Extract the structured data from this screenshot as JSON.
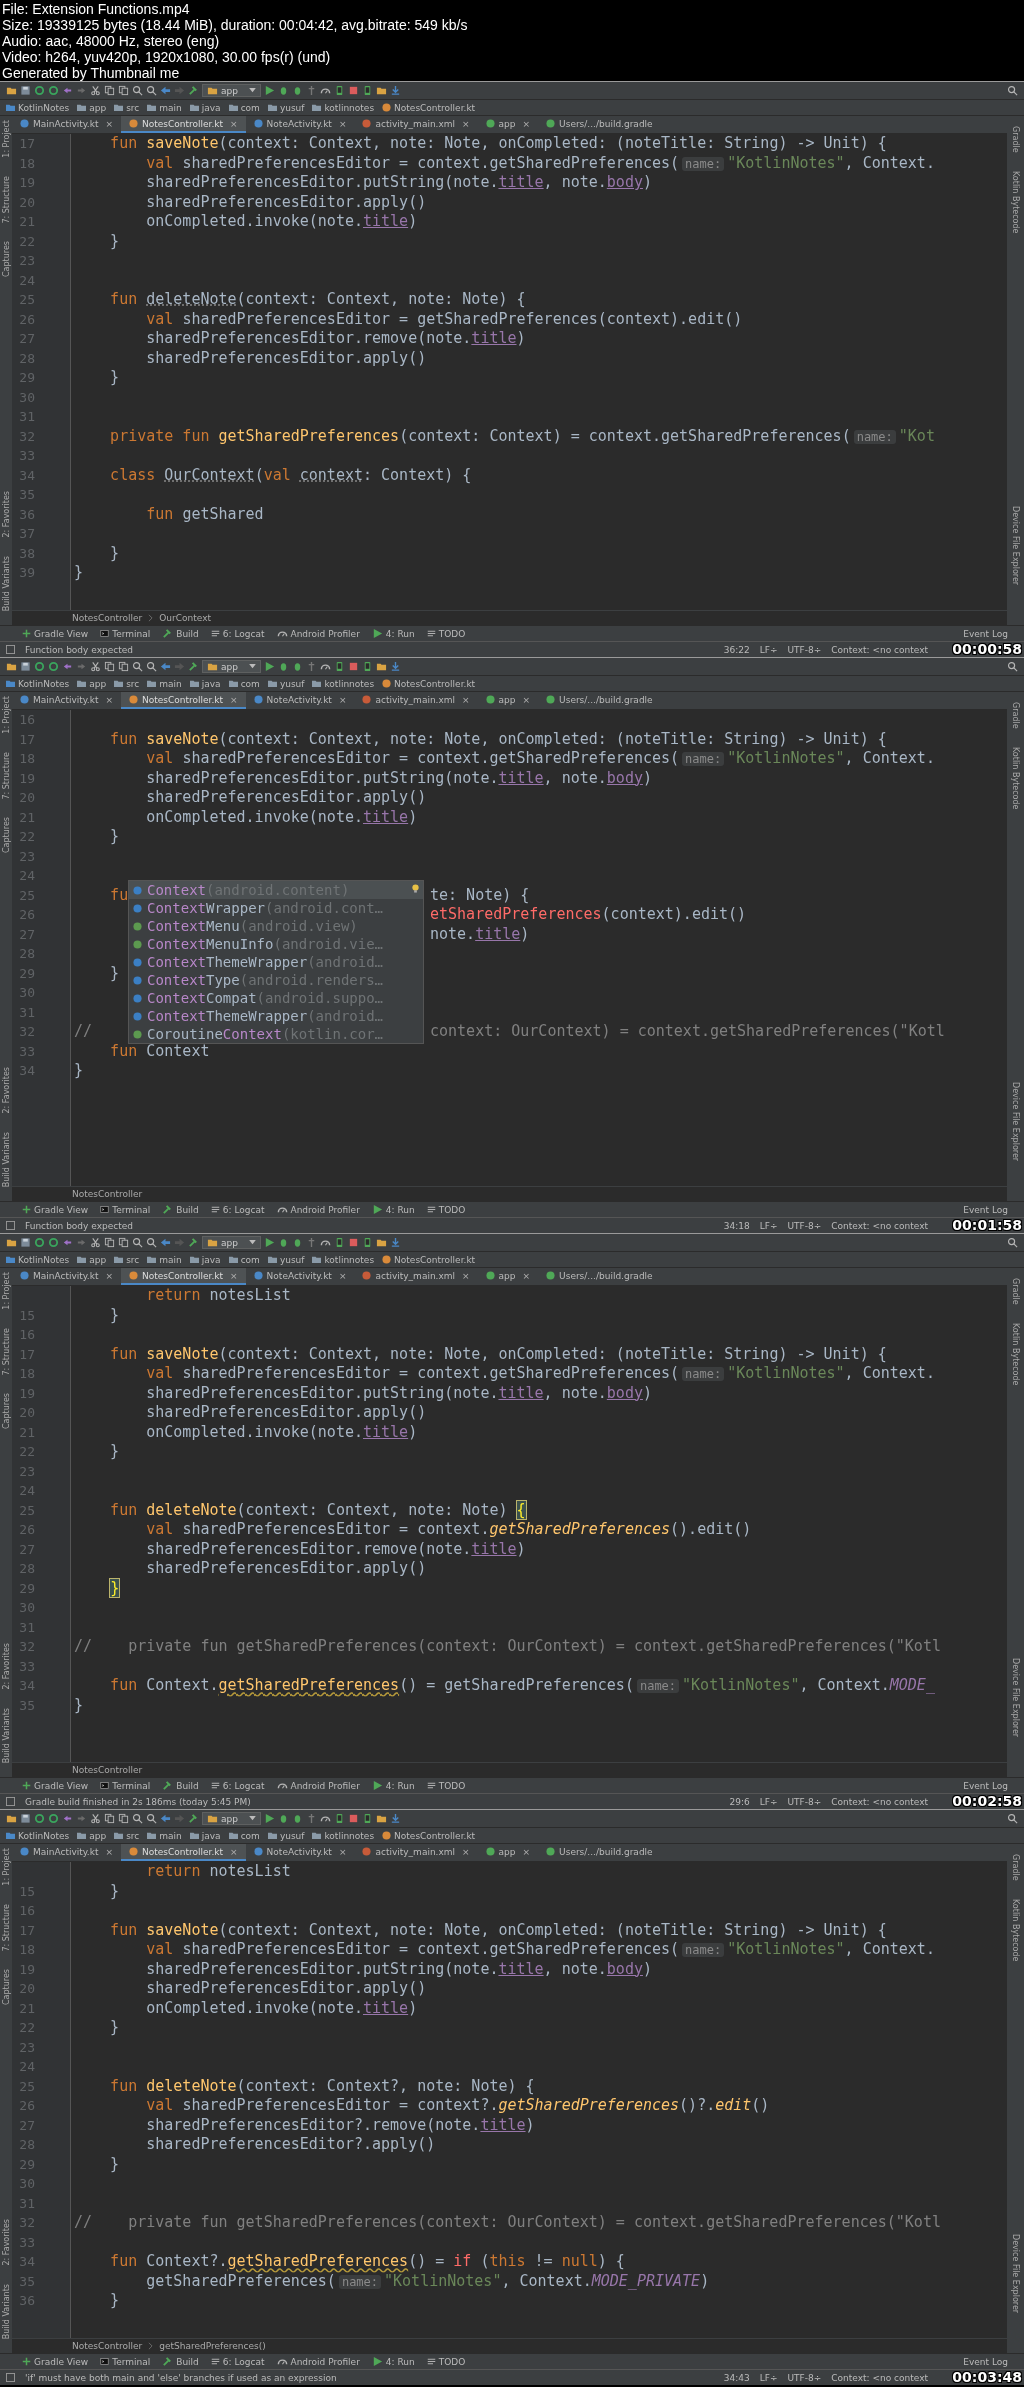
{
  "info": [
    "File: Extension Functions.mp4",
    "Size: 19339125 bytes (18.44 MiB), duration: 00:04:42, avg.bitrate: 549 kb/s",
    "Audio: aac, 48000 Hz, stereo (eng)",
    "Video: h264, yuv420p, 1920x1080, 30.00 fps(r) (und)",
    "Generated by Thumbnail me"
  ],
  "frames": [
    {
      "timestamp": "00:00:58",
      "run_config": "app",
      "breadcrumbs": [
        "KotlinNotes",
        "app",
        "src",
        "main",
        "java",
        "com",
        "yusuf",
        "kotlinnotes",
        "NotesController.kt"
      ],
      "tabs": [
        {
          "label": "MainActivity.kt",
          "kind": "kotlin-class",
          "selected": false,
          "close": "×"
        },
        {
          "label": "NotesController.kt",
          "kind": "kotlin-file",
          "selected": true,
          "close": "×"
        },
        {
          "label": "NoteActivity.kt",
          "kind": "kotlin-class",
          "selected": false,
          "close": "×"
        },
        {
          "label": "activity_main.xml",
          "kind": "layout",
          "selected": false,
          "close": "×"
        },
        {
          "label": "app",
          "kind": "gradle",
          "selected": false,
          "close": "×"
        },
        {
          "label": "Users/.../build.gradle",
          "kind": "gradle",
          "selected": false
        }
      ],
      "left_strip": {
        "top": [
          "1: Project",
          "7: Structure",
          "Captures"
        ],
        "bottom": [
          "2: Favorites",
          "Build Variants"
        ]
      },
      "right_strip": {
        "top": [
          "Gradle",
          "Kotlin Bytecode"
        ],
        "bottom": [
          "Device File Explorer"
        ]
      },
      "editor": {
        "lines": [
          {
            "num": "17",
            "tokens": [
              {
                "kind": "kw",
                "text": "    fun "
              },
              {
                "kind": "decl",
                "text": "saveNote"
              },
              {
                "kind": "text",
                "text": "(context: Context, note: Note, onCompleted: (noteTitle: String) -> Unit) {"
              }
            ]
          },
          {
            "num": "18",
            "tokens": [
              {
                "kind": "kw",
                "text": "        val "
              },
              {
                "kind": "text",
                "text": "sharedPreferencesEditor = context.getSharedPreferences("
              },
              {
                "kind": "hint",
                "text": "name:"
              },
              {
                "kind": "str",
                "text": "\"KotlinNotes\""
              },
              {
                "kind": "text",
                "text": ", Context."
              }
            ]
          },
          {
            "num": "19",
            "tokens": [
              {
                "kind": "text",
                "text": "        sharedPreferencesEditor.putString(note."
              },
              {
                "kind": "prop",
                "text": "title"
              },
              {
                "kind": "text",
                "text": ", note."
              },
              {
                "kind": "prop",
                "text": "body"
              },
              {
                "kind": "text",
                "text": ")"
              }
            ]
          },
          {
            "num": "20",
            "tokens": [
              {
                "kind": "text",
                "text": "        sharedPreferencesEditor.apply()"
              }
            ]
          },
          {
            "num": "21",
            "tokens": [
              {
                "kind": "text",
                "text": "        onCompleted.invoke(note."
              },
              {
                "kind": "prop",
                "text": "title"
              },
              {
                "kind": "text",
                "text": ")"
              }
            ]
          },
          {
            "num": "22",
            "tokens": [
              {
                "kind": "text",
                "text": "    }"
              }
            ]
          },
          {
            "num": "23"
          },
          {
            "num": "24"
          },
          {
            "num": "25",
            "tokens": [
              {
                "kind": "kw",
                "text": "    fun "
              },
              {
                "kind": "unused",
                "text": "deleteNote"
              },
              {
                "kind": "text",
                "text": "(context: Context, note: Note) {"
              }
            ]
          },
          {
            "num": "26",
            "tokens": [
              {
                "kind": "kw",
                "text": "        val "
              },
              {
                "kind": "text",
                "text": "sharedPreferencesEditor = getSharedPreferences(context).edit()"
              }
            ]
          },
          {
            "num": "27",
            "tokens": [
              {
                "kind": "text",
                "text": "        sharedPreferencesEditor.remove(note."
              },
              {
                "kind": "prop",
                "text": "title"
              },
              {
                "kind": "text",
                "text": ")"
              }
            ]
          },
          {
            "num": "28",
            "tokens": [
              {
                "kind": "text",
                "text": "        sharedPreferencesEditor.apply()"
              }
            ]
          },
          {
            "num": "29",
            "tokens": [
              {
                "kind": "text",
                "text": "    }"
              }
            ]
          },
          {
            "num": "30"
          },
          {
            "num": "31"
          },
          {
            "num": "32",
            "tokens": [
              {
                "kind": "kw",
                "text": "    private fun "
              },
              {
                "kind": "decl",
                "text": "getSharedPreferences"
              },
              {
                "kind": "text",
                "text": "(context: Context) = context.getSharedPreferences("
              },
              {
                "kind": "hint",
                "text": "name:"
              },
              {
                "kind": "str",
                "text": "\"Kot"
              }
            ]
          },
          {
            "num": "33"
          },
          {
            "num": "34",
            "tokens": [
              {
                "kind": "kw",
                "text": "    class "
              },
              {
                "kind": "unused",
                "text": "OurContext"
              },
              {
                "kind": "text",
                "text": "("
              },
              {
                "kind": "kw",
                "text": "val "
              },
              {
                "kind": "unused",
                "text": "context"
              },
              {
                "kind": "text",
                "text": ": Context) {"
              }
            ]
          },
          {
            "num": "35"
          },
          {
            "num": "36",
            "tokens": [
              {
                "kind": "kw",
                "text": "        fun "
              },
              {
                "kind": "text",
                "text": "getShared"
              }
            ]
          },
          {
            "num": "37"
          },
          {
            "num": "38",
            "tokens": [
              {
                "kind": "text",
                "text": "    }"
              }
            ]
          },
          {
            "num": "39",
            "tokens": [
              {
                "kind": "text",
                "text": "}"
              }
            ]
          }
        ]
      },
      "code_path": [
        "NotesController",
        "OurContext"
      ],
      "tool_windows": [
        "Gradle View",
        "Terminal",
        "Build",
        "6: Logcat",
        "Android Profiler",
        "4: Run",
        "TODO"
      ],
      "event_log": "Event Log",
      "status": {
        "message": "Function body expected",
        "position": "36:22",
        "line_sep": "LF÷",
        "encoding": "UTF-8÷",
        "context": "Context: <no context"
      }
    },
    {
      "timestamp": "00:01:58",
      "run_config": "app",
      "breadcrumbs": [
        "KotlinNotes",
        "app",
        "src",
        "main",
        "java",
        "com",
        "yusuf",
        "kotlinnotes",
        "NotesController.kt"
      ],
      "tabs": [
        {
          "label": "MainActivity.kt",
          "kind": "kotlin-class",
          "selected": false,
          "close": "×"
        },
        {
          "label": "NotesController.kt",
          "kind": "kotlin-file",
          "selected": true,
          "close": "×"
        },
        {
          "label": "NoteActivity.kt",
          "kind": "kotlin-class",
          "selected": false,
          "close": "×"
        },
        {
          "label": "activity_main.xml",
          "kind": "layout",
          "selected": false,
          "close": "×"
        },
        {
          "label": "app",
          "kind": "gradle",
          "selected": false,
          "close": "×"
        },
        {
          "label": "Users/.../build.gradle",
          "kind": "gradle",
          "selected": false
        }
      ],
      "left_strip": {
        "top": [
          "1: Project",
          "7: Structure",
          "Captures"
        ],
        "bottom": [
          "2: Favorites",
          "Build Variants"
        ]
      },
      "right_strip": {
        "top": [
          "Gradle",
          "Kotlin Bytecode"
        ],
        "bottom": [
          "Device File Explorer"
        ]
      },
      "editor": {
        "lines": [
          {
            "num": "16"
          },
          {
            "num": "17",
            "tokens": [
              {
                "kind": "kw",
                "text": "    fun "
              },
              {
                "kind": "decl",
                "text": "saveNote"
              },
              {
                "kind": "text",
                "text": "(context: Context, note: Note, onCompleted: (noteTitle: String) -> Unit) {"
              }
            ]
          },
          {
            "num": "18",
            "tokens": [
              {
                "kind": "kw",
                "text": "        val "
              },
              {
                "kind": "text",
                "text": "sharedPreferencesEditor = context.getSharedPreferences("
              },
              {
                "kind": "hint",
                "text": "name:"
              },
              {
                "kind": "str",
                "text": "\"KotlinNotes\""
              },
              {
                "kind": "text",
                "text": ", Context."
              }
            ]
          },
          {
            "num": "19",
            "tokens": [
              {
                "kind": "text",
                "text": "        sharedPreferencesEditor.putString(note."
              },
              {
                "kind": "prop",
                "text": "title"
              },
              {
                "kind": "text",
                "text": ", note."
              },
              {
                "kind": "prop",
                "text": "body"
              },
              {
                "kind": "text",
                "text": ")"
              }
            ]
          },
          {
            "num": "20",
            "tokens": [
              {
                "kind": "text",
                "text": "        sharedPreferencesEditor.apply()"
              }
            ]
          },
          {
            "num": "21",
            "tokens": [
              {
                "kind": "text",
                "text": "        onCompleted.invoke(note."
              },
              {
                "kind": "prop",
                "text": "title"
              },
              {
                "kind": "text",
                "text": ")"
              }
            ]
          },
          {
            "num": "22",
            "tokens": [
              {
                "kind": "text",
                "text": "    }"
              }
            ]
          },
          {
            "num": "23"
          },
          {
            "num": "24"
          },
          {
            "num": "25",
            "tokens": [
              {
                "kind": "kw",
                "text": "    fu"
              }
            ],
            "beside_popup": [
              {
                "kind": "text",
                "text": "te: Note) {"
              }
            ]
          },
          {
            "num": "26",
            "beside_popup": [
              {
                "kind": "err",
                "text": "etSharedPreferences"
              },
              {
                "kind": "text",
                "text": "(context).edit()"
              }
            ]
          },
          {
            "num": "27",
            "beside_popup": [
              {
                "kind": "text",
                "text": "note."
              },
              {
                "kind": "prop",
                "text": "title"
              },
              {
                "kind": "text",
                "text": ")"
              }
            ]
          },
          {
            "num": "28"
          },
          {
            "num": "29",
            "tokens": [
              {
                "kind": "text",
                "text": "    }"
              }
            ]
          },
          {
            "num": "30"
          },
          {
            "num": "31"
          },
          {
            "num": "32",
            "tokens": [
              {
                "kind": "comment",
                "text": "//"
              }
            ],
            "beside_popup": [
              {
                "kind": "comment",
                "text": "context: OurContext) = context.getSharedPreferences(\"Kotl"
              }
            ]
          },
          {
            "num": "33",
            "tokens": [
              {
                "kind": "kw",
                "text": "    fun "
              },
              {
                "kind": "text",
                "text": "Context"
              }
            ]
          },
          {
            "num": "34",
            "tokens": [
              {
                "kind": "text",
                "text": "}"
              }
            ]
          }
        ],
        "popup": {
          "items": [
            {
              "kind": "class",
              "match": "Context",
              "package": "(android.content)",
              "selected": true
            },
            {
              "kind": "class",
              "match": "Context",
              "rest": "Wrapper",
              "package": "(android.cont…",
              "selected": false
            },
            {
              "kind": "interface",
              "match": "Context",
              "rest": "Menu",
              "package": "(android.view)",
              "selected": false
            },
            {
              "kind": "interface",
              "match": "Context",
              "rest": "MenuInfo",
              "package": "(android.vie…",
              "selected": false
            },
            {
              "kind": "class",
              "match": "Context",
              "rest": "ThemeWrapper",
              "package": "(android…",
              "selected": false
            },
            {
              "kind": "class",
              "match": "Context",
              "rest": "Type",
              "package": "(android.renders…",
              "selected": false
            },
            {
              "kind": "class",
              "match": "Context",
              "rest": "Compat",
              "package": "(android.suppo…",
              "selected": false
            },
            {
              "kind": "class",
              "match": "Context",
              "rest": "ThemeWrapper",
              "package": "(android…",
              "selected": false
            },
            {
              "kind": "interface",
              "prefix": "Coroutine",
              "match": "Context",
              "package": "(kotlin.cor…",
              "selected": false
            }
          ]
        }
      },
      "code_path": [
        "NotesController"
      ],
      "tool_windows": [
        "Gradle View",
        "Terminal",
        "Build",
        "6: Logcat",
        "Android Profiler",
        "4: Run",
        "TODO"
      ],
      "event_log": "Event Log",
      "status": {
        "message": "Function body expected",
        "position": "34:18",
        "line_sep": "LF÷",
        "encoding": "UTF-8÷",
        "context": "Context: <no context"
      }
    },
    {
      "timestamp": "00:02:58",
      "run_config": "app",
      "breadcrumbs": [
        "KotlinNotes",
        "app",
        "src",
        "main",
        "java",
        "com",
        "yusuf",
        "kotlinnotes",
        "NotesController.kt"
      ],
      "tabs": [
        {
          "label": "MainActivity.kt",
          "kind": "kotlin-class",
          "selected": false,
          "close": "×"
        },
        {
          "label": "NotesController.kt",
          "kind": "kotlin-file",
          "selected": true,
          "close": "×"
        },
        {
          "label": "NoteActivity.kt",
          "kind": "kotlin-class",
          "selected": false,
          "close": "×"
        },
        {
          "label": "activity_main.xml",
          "kind": "layout",
          "selected": false,
          "close": "×"
        },
        {
          "label": "app",
          "kind": "gradle",
          "selected": false,
          "close": "×"
        },
        {
          "label": "Users/.../build.gradle",
          "kind": "gradle",
          "selected": false
        }
      ],
      "left_strip": {
        "top": [
          "1: Project",
          "7: Structure",
          "Captures"
        ],
        "bottom": [
          "2: Favorites",
          "Build Variants"
        ]
      },
      "right_strip": {
        "top": [
          "Gradle",
          "Kotlin Bytecode"
        ],
        "bottom": [
          "Device File Explorer"
        ]
      },
      "editor": {
        "lines": [
          {
            "tokens": [
              {
                "kind": "kw",
                "text": "        return "
              },
              {
                "kind": "text",
                "text": "notesList"
              }
            ]
          },
          {
            "num": "15",
            "tokens": [
              {
                "kind": "text",
                "text": "    }"
              }
            ]
          },
          {
            "num": "16"
          },
          {
            "num": "17",
            "tokens": [
              {
                "kind": "kw",
                "text": "    fun "
              },
              {
                "kind": "decl",
                "text": "saveNote"
              },
              {
                "kind": "text",
                "text": "(context: Context, note: Note, onCompleted: (noteTitle: String) -> Unit) {"
              }
            ]
          },
          {
            "num": "18",
            "tokens": [
              {
                "kind": "kw",
                "text": "        val "
              },
              {
                "kind": "text",
                "text": "sharedPreferencesEditor = context.getSharedPreferences("
              },
              {
                "kind": "hint",
                "text": "name:"
              },
              {
                "kind": "str",
                "text": "\"KotlinNotes\""
              },
              {
                "kind": "text",
                "text": ", Context."
              }
            ]
          },
          {
            "num": "19",
            "tokens": [
              {
                "kind": "text",
                "text": "        sharedPreferencesEditor.putString(note."
              },
              {
                "kind": "prop",
                "text": "title"
              },
              {
                "kind": "text",
                "text": ", note."
              },
              {
                "kind": "prop",
                "text": "body"
              },
              {
                "kind": "text",
                "text": ")"
              }
            ]
          },
          {
            "num": "20",
            "tokens": [
              {
                "kind": "text",
                "text": "        sharedPreferencesEditor.apply()"
              }
            ]
          },
          {
            "num": "21",
            "tokens": [
              {
                "kind": "text",
                "text": "        onCompleted.invoke(note."
              },
              {
                "kind": "prop",
                "text": "title"
              },
              {
                "kind": "text",
                "text": ")"
              }
            ]
          },
          {
            "num": "22",
            "tokens": [
              {
                "kind": "text",
                "text": "    }"
              }
            ]
          },
          {
            "num": "23"
          },
          {
            "num": "24"
          },
          {
            "num": "25",
            "tokens": [
              {
                "kind": "kw",
                "text": "    fun "
              },
              {
                "kind": "decl",
                "text": "deleteNote"
              },
              {
                "kind": "text",
                "text": "(context: Context, note: Note) "
              },
              {
                "kind": "match",
                "text": "{"
              }
            ]
          },
          {
            "num": "26",
            "tokens": [
              {
                "kind": "kw",
                "text": "        val "
              },
              {
                "kind": "text",
                "text": "sharedPreferencesEditor = context."
              },
              {
                "kind": "call",
                "text": "getSharedPreferences"
              },
              {
                "kind": "text",
                "text": "().edit()"
              }
            ]
          },
          {
            "num": "27",
            "tokens": [
              {
                "kind": "text",
                "text": "        sharedPreferencesEditor.remove(note."
              },
              {
                "kind": "prop",
                "text": "title"
              },
              {
                "kind": "text",
                "text": ")"
              }
            ]
          },
          {
            "num": "28",
            "tokens": [
              {
                "kind": "text",
                "text": "        sharedPreferencesEditor.apply()"
              }
            ]
          },
          {
            "num": "29",
            "tokens": [
              {
                "kind": "match",
                "text": "    }"
              }
            ]
          },
          {
            "num": "30"
          },
          {
            "num": "31"
          },
          {
            "num": "32",
            "tokens": [
              {
                "kind": "comment",
                "text": "//    private fun getSharedPreferences(context: OurContext) = context.getSharedPreferences(\"Kotl"
              }
            ]
          },
          {
            "num": "33"
          },
          {
            "num": "34",
            "tokens": [
              {
                "kind": "kw",
                "text": "    fun "
              },
              {
                "kind": "text",
                "text": "Context."
              },
              {
                "kind": "ext",
                "text": "getSharedPreferences"
              },
              {
                "kind": "text",
                "text": "() = getSharedPreferences("
              },
              {
                "kind": "hint",
                "text": "name:"
              },
              {
                "kind": "str",
                "text": "\"KotlinNotes\""
              },
              {
                "kind": "text",
                "text": ", Context."
              },
              {
                "kind": "const",
                "text": "MODE_"
              }
            ]
          },
          {
            "num": "35",
            "tokens": [
              {
                "kind": "text",
                "text": "}"
              }
            ]
          }
        ]
      },
      "code_path": [
        "NotesController"
      ],
      "tool_windows": [
        "Gradle View",
        "Terminal",
        "Build",
        "6: Logcat",
        "Android Profiler",
        "4: Run",
        "TODO"
      ],
      "event_log": "Event Log",
      "status": {
        "message": "Gradle build finished in 2s 186ms (today 5:45 PM)",
        "position": "29:6",
        "line_sep": "LF÷",
        "encoding": "UTF-8÷",
        "context": "Context: <no context"
      }
    },
    {
      "timestamp": "00:03:48",
      "run_config": "app",
      "breadcrumbs": [
        "KotlinNotes",
        "app",
        "src",
        "main",
        "java",
        "com",
        "yusuf",
        "kotlinnotes",
        "NotesController.kt"
      ],
      "tabs": [
        {
          "label": "MainActivity.kt",
          "kind": "kotlin-class",
          "selected": false,
          "close": "×"
        },
        {
          "label": "NotesController.kt",
          "kind": "kotlin-file",
          "selected": true,
          "close": "×"
        },
        {
          "label": "NoteActivity.kt",
          "kind": "kotlin-class",
          "selected": false,
          "close": "×"
        },
        {
          "label": "activity_main.xml",
          "kind": "layout",
          "selected": false,
          "close": "×"
        },
        {
          "label": "app",
          "kind": "gradle",
          "selected": false,
          "close": "×"
        },
        {
          "label": "Users/.../build.gradle",
          "kind": "gradle",
          "selected": false
        }
      ],
      "left_strip": {
        "top": [
          "1: Project",
          "7: Structure",
          "Captures"
        ],
        "bottom": [
          "2: Favorites",
          "Build Variants"
        ]
      },
      "right_strip": {
        "top": [
          "Gradle",
          "Kotlin Bytecode"
        ],
        "bottom": [
          "Device File Explorer"
        ]
      },
      "editor": {
        "lines": [
          {
            "tokens": [
              {
                "kind": "kw",
                "text": "        return "
              },
              {
                "kind": "text",
                "text": "notesList"
              }
            ]
          },
          {
            "num": "15",
            "tokens": [
              {
                "kind": "text",
                "text": "    }"
              }
            ]
          },
          {
            "num": "16"
          },
          {
            "num": "17",
            "tokens": [
              {
                "kind": "kw",
                "text": "    fun "
              },
              {
                "kind": "decl",
                "text": "saveNote"
              },
              {
                "kind": "text",
                "text": "(context: Context, note: Note, onCompleted: (noteTitle: String) -> Unit) {"
              }
            ]
          },
          {
            "num": "18",
            "tokens": [
              {
                "kind": "kw",
                "text": "        val "
              },
              {
                "kind": "text",
                "text": "sharedPreferencesEditor = context.getSharedPreferences("
              },
              {
                "kind": "hint",
                "text": "name:"
              },
              {
                "kind": "str",
                "text": "\"KotlinNotes\""
              },
              {
                "kind": "text",
                "text": ", Context."
              }
            ]
          },
          {
            "num": "19",
            "tokens": [
              {
                "kind": "text",
                "text": "        sharedPreferencesEditor.putString(note."
              },
              {
                "kind": "prop",
                "text": "title"
              },
              {
                "kind": "text",
                "text": ", note."
              },
              {
                "kind": "prop",
                "text": "body"
              },
              {
                "kind": "text",
                "text": ")"
              }
            ]
          },
          {
            "num": "20",
            "tokens": [
              {
                "kind": "text",
                "text": "        sharedPreferencesEditor.apply()"
              }
            ]
          },
          {
            "num": "21",
            "tokens": [
              {
                "kind": "text",
                "text": "        onCompleted.invoke(note."
              },
              {
                "kind": "prop",
                "text": "title"
              },
              {
                "kind": "text",
                "text": ")"
              }
            ]
          },
          {
            "num": "22",
            "tokens": [
              {
                "kind": "text",
                "text": "    }"
              }
            ]
          },
          {
            "num": "23"
          },
          {
            "num": "24"
          },
          {
            "num": "25",
            "tokens": [
              {
                "kind": "kw",
                "text": "    fun "
              },
              {
                "kind": "decl",
                "text": "deleteNote"
              },
              {
                "kind": "text",
                "text": "(context: Context?, note: Note) {"
              }
            ]
          },
          {
            "num": "26",
            "tokens": [
              {
                "kind": "kw",
                "text": "        val "
              },
              {
                "kind": "text",
                "text": "sharedPreferencesEditor = context?."
              },
              {
                "kind": "call",
                "text": "getSharedPreferences"
              },
              {
                "kind": "text",
                "text": "()?."
              },
              {
                "kind": "call",
                "text": "edit"
              },
              {
                "kind": "text",
                "text": "()"
              }
            ]
          },
          {
            "num": "27",
            "tokens": [
              {
                "kind": "text",
                "text": "        sharedPreferencesEditor?.remove(note."
              },
              {
                "kind": "prop",
                "text": "title"
              },
              {
                "kind": "text",
                "text": ")"
              }
            ]
          },
          {
            "num": "28",
            "tokens": [
              {
                "kind": "text",
                "text": "        sharedPreferencesEditor?.apply()"
              }
            ]
          },
          {
            "num": "29",
            "tokens": [
              {
                "kind": "text",
                "text": "    }"
              }
            ]
          },
          {
            "num": "30"
          },
          {
            "num": "31"
          },
          {
            "num": "32",
            "tokens": [
              {
                "kind": "comment",
                "text": "//    private fun getSharedPreferences(context: OurContext) = context.getSharedPreferences(\"Kotl"
              }
            ]
          },
          {
            "num": "33"
          },
          {
            "num": "34",
            "tokens": [
              {
                "kind": "kw",
                "text": "    fun "
              },
              {
                "kind": "text",
                "text": "Context?."
              },
              {
                "kind": "ext",
                "text": "getSharedPreferences"
              },
              {
                "kind": "text",
                "text": "() = "
              },
              {
                "kind": "err",
                "text": "if"
              },
              {
                "kind": "text",
                "text": " ("
              },
              {
                "kind": "kw",
                "text": "this"
              },
              {
                "kind": "text",
                "text": " != "
              },
              {
                "kind": "kw",
                "text": "null"
              },
              {
                "kind": "text",
                "text": ") {"
              }
            ]
          },
          {
            "num": "35",
            "tokens": [
              {
                "kind": "text",
                "text": "        getSharedPreferences("
              },
              {
                "kind": "hint",
                "text": "name:"
              },
              {
                "kind": "str",
                "text": "\"KotlinNotes\""
              },
              {
                "kind": "text",
                "text": ", Context."
              },
              {
                "kind": "const",
                "text": "MODE_PRIVATE"
              },
              {
                "kind": "text",
                "text": ")"
              }
            ]
          },
          {
            "num": "36",
            "tokens": [
              {
                "kind": "text",
                "text": "    }"
              }
            ]
          }
        ]
      },
      "code_path": [
        "NotesController",
        "getSharedPreferences()"
      ],
      "tool_windows": [
        "Gradle View",
        "Terminal",
        "Build",
        "6: Logcat",
        "Android Profiler",
        "4: Run",
        "TODO"
      ],
      "event_log": "Event Log",
      "status": {
        "message": "'if' must have both main and 'else' branches if used as an expression",
        "position": "34:43",
        "line_sep": "LF÷",
        "encoding": "UTF-8÷",
        "context": "Context: <no context"
      }
    }
  ]
}
